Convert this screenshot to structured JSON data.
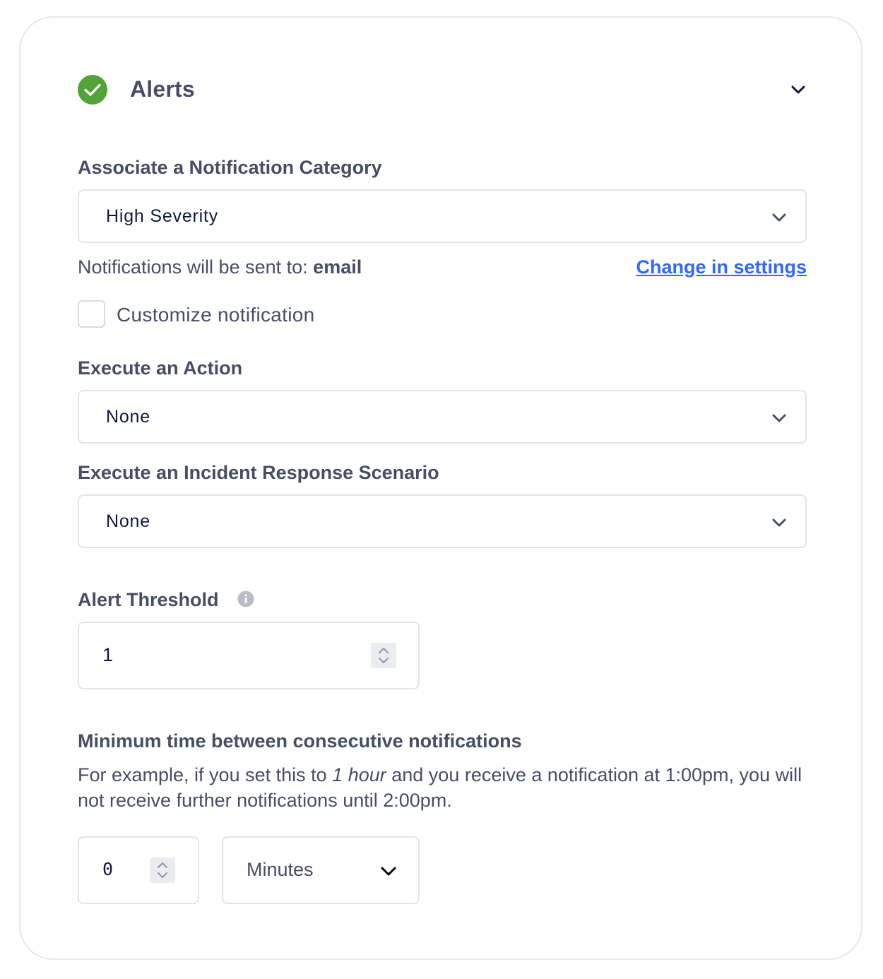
{
  "section": {
    "title": "Alerts",
    "status_icon": "check-circle-icon",
    "collapse_icon": "chevron-down-icon",
    "status_color": "#52a43a"
  },
  "notification_category": {
    "label": "Associate a Notification Category",
    "selected": "High Severity",
    "sent_to_prefix": "Notifications will be sent to:",
    "sent_to_value": "email",
    "change_link": "Change in settings"
  },
  "customize": {
    "label": "Customize notification",
    "checked": false
  },
  "action": {
    "label": "Execute an Action",
    "selected": "None"
  },
  "incident_response": {
    "label": "Execute an Incident Response Scenario",
    "selected": "None"
  },
  "alert_threshold": {
    "label": "Alert Threshold",
    "value": "1",
    "info_icon": "info-icon"
  },
  "min_time": {
    "label": "Minimum time between consecutive notifications",
    "desc_part1": "For example, if you set this to",
    "desc_em": "1 hour",
    "desc_part2": "and you receive a notification at 1:00pm, you will not receive further notifications until 2:00pm.",
    "value": "0",
    "unit": "Minutes"
  },
  "colors": {
    "accent_link": "#3366ff",
    "text": "#474d66",
    "border": "#e3e5ec"
  }
}
